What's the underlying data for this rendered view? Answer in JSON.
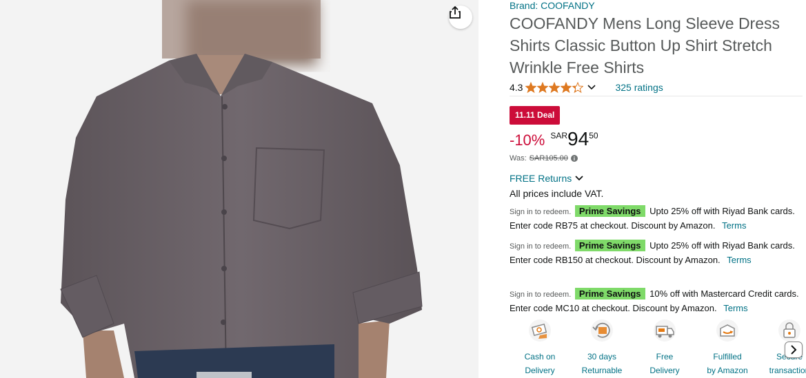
{
  "product": {
    "brand_label": "Brand: COOFANDY",
    "title": "COOFANDY Mens Long Sleeve Dress Shirts Classic Button Up Shirt Stretch Wrinkle Free Shirts",
    "rating_value": "4.3",
    "rating_stars": 4.3,
    "ratings_count": "325 ratings"
  },
  "pricing": {
    "deal_badge": "11.11 Deal",
    "discount": "-10%",
    "currency": "SAR",
    "price_whole": "94",
    "price_fraction": "50",
    "was_label": "Was:",
    "was_price": "SAR105.00",
    "free_returns": "FREE Returns",
    "vat_note": "All prices include VAT."
  },
  "promotions": [
    {
      "signin": "Sign in to redeem.",
      "badge": "Prime Savings",
      "text": "Upto 25% off with Riyad Bank cards. Enter code RB75 at checkout. Discount by Amazon.",
      "terms": "Terms"
    },
    {
      "signin": "Sign in to redeem.",
      "badge": "Prime Savings",
      "text": "Upto 25% off with Riyad Bank cards. Enter code RB150 at checkout. Discount by Amazon.",
      "terms": "Terms"
    },
    {
      "signin": "Sign in to redeem.",
      "badge": "Prime Savings",
      "text": "10% off with Mastercard Credit cards. Enter code MC10 at checkout. Discount by Amazon.",
      "terms": "Terms"
    }
  ],
  "features": [
    {
      "label": "Cash on\nDelivery",
      "icon": "cash-on-delivery-icon"
    },
    {
      "label": "30 days\nReturnable",
      "icon": "returnable-icon"
    },
    {
      "label": "Free\nDelivery",
      "icon": "free-delivery-icon"
    },
    {
      "label": "Fulfilled\nby Amazon",
      "icon": "fulfilled-by-amazon-icon"
    },
    {
      "label": "Secure\ntransaction",
      "icon": "secure-transaction-icon"
    }
  ],
  "colors": {
    "link": "#007185",
    "deal_red": "#cc0c39",
    "star": "#de7921",
    "prime_green": "#7fda69",
    "shirt": "#6b6268"
  }
}
